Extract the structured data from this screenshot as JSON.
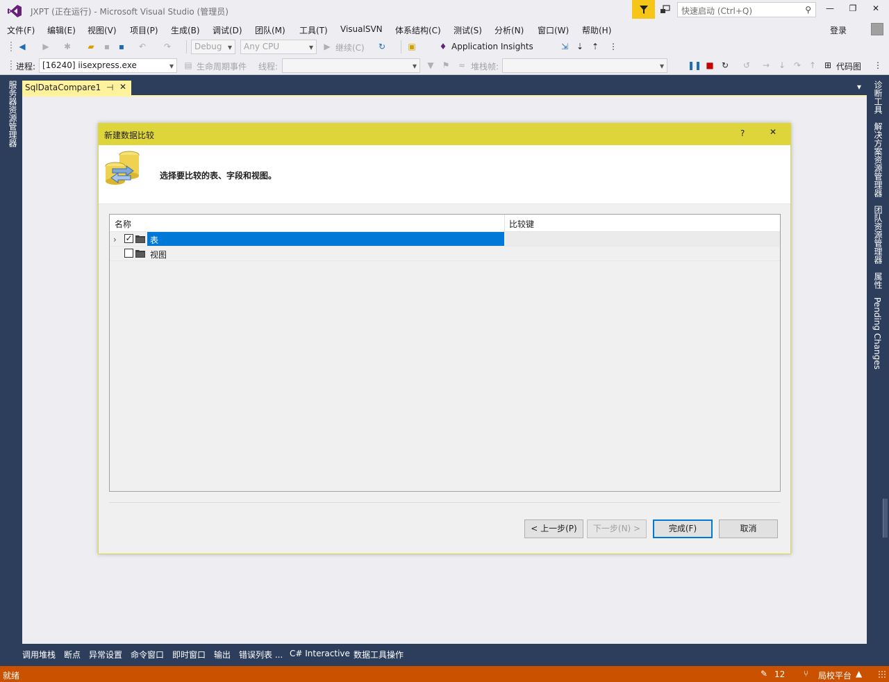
{
  "window": {
    "title": "JXPT (正在运行) - Microsoft Visual Studio (管理员)",
    "quick_launch_placeholder": "快速启动 (Ctrl+Q)",
    "minimize": "—",
    "maximize": "❐",
    "close": "✕"
  },
  "menu": {
    "items": [
      "文件(F)",
      "编辑(E)",
      "视图(V)",
      "项目(P)",
      "生成(B)",
      "调试(D)",
      "团队(M)",
      "工具(T)",
      "VisualSVN",
      "体系结构(C)",
      "测试(S)",
      "分析(N)",
      "窗口(W)",
      "帮助(H)"
    ],
    "signin": "登录"
  },
  "toolbar1": {
    "config": "Debug",
    "platform": "Any CPU",
    "continue": "继续(C)",
    "app_insights": "Application Insights"
  },
  "toolbar2": {
    "process_label": "进程:",
    "process_value": "[16240] iisexpress.exe",
    "lifecycle": "生命周期事件",
    "thread_label": "线程:",
    "stack_label": "堆栈帧:",
    "code_map": "代码图"
  },
  "left_tab": "服务器资源管理器",
  "right_tabs": [
    "诊断工具",
    "解决方案资源管理器",
    "团队资源管理器",
    "属性",
    "Pending Changes"
  ],
  "doc_tab": {
    "label": "SqlDataCompare1",
    "pin": "⊣",
    "close": "✕",
    "overflow": "▾"
  },
  "dialog": {
    "title": "新建数据比较",
    "help": "?",
    "close": "✕",
    "instruction": "选择要比较的表、字段和视图。",
    "columns": [
      "名称",
      "比较键"
    ],
    "rows": [
      {
        "label": "表",
        "checked": "✓",
        "expander": "›",
        "selected": true
      },
      {
        "label": "视图",
        "checked": "",
        "expander": "",
        "selected": false
      }
    ],
    "buttons": {
      "back": "< 上一步(P)",
      "next": "下一步(N) >",
      "finish": "完成(F)",
      "cancel": "取消"
    }
  },
  "bottom_tabs": [
    "调用堆栈",
    "断点",
    "异常设置",
    "命令窗口",
    "即时窗口",
    "输出",
    "错误列表 ...",
    "C# Interactive",
    "数据工具操作"
  ],
  "status": {
    "text": "就绪",
    "changes_count": "12",
    "repo": "局校平台",
    "pencil": "✎",
    "branch": "⑂",
    "up_arrow": "▲"
  },
  "colors": {
    "accent_blue": "#0078d7",
    "dialog_title": "#ddd53a",
    "status_orange": "#ca5100",
    "chrome_bg": "#eeeef2",
    "frame_dark": "#2d3e5c"
  }
}
